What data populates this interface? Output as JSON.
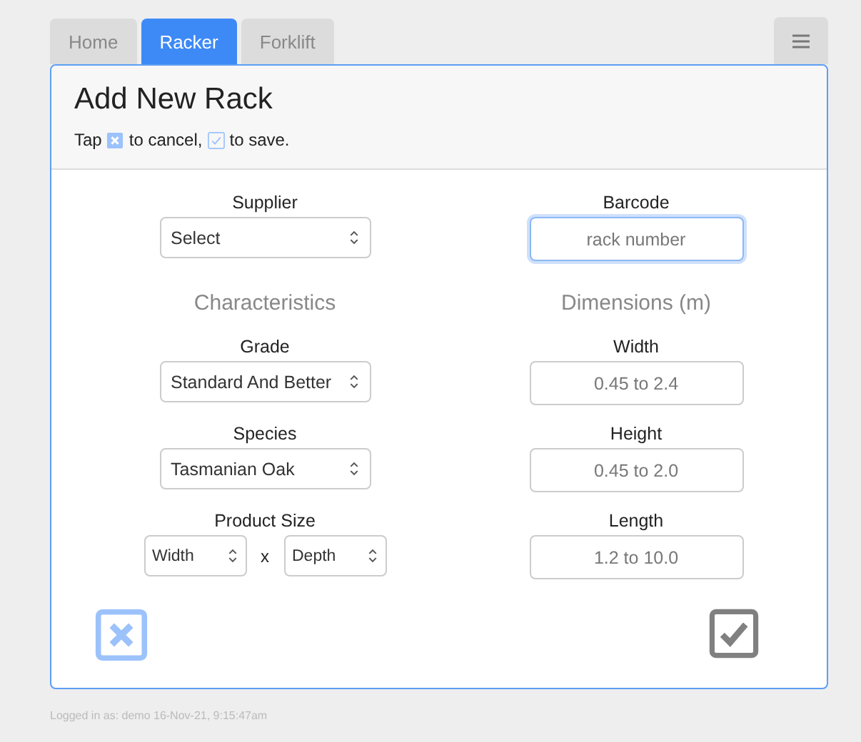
{
  "tabs": [
    {
      "label": "Home",
      "selected": false
    },
    {
      "label": "Racker",
      "selected": true
    },
    {
      "label": "Forklift",
      "selected": false
    }
  ],
  "title": "Add New Rack",
  "instructions": {
    "before": "Tap",
    "middle": "to cancel,",
    "after": "to save."
  },
  "rows": [
    {
      "left": {
        "kind": "select",
        "label": "Supplier",
        "value": "Select"
      },
      "right": {
        "kind": "input",
        "label": "Barcode",
        "placeholder": "rack number",
        "focused": true
      }
    },
    {
      "left": {
        "kind": "heading",
        "label": "Characteristics"
      },
      "right": {
        "kind": "heading",
        "label": "Dimensions (m)"
      }
    },
    {
      "left": {
        "kind": "select",
        "label": "Grade",
        "value": "Standard And Better"
      },
      "right": {
        "kind": "input",
        "label": "Width",
        "placeholder": "0.45 to 2.4",
        "focused": false
      }
    },
    {
      "left": {
        "kind": "select",
        "label": "Species",
        "value": "Tasmanian Oak"
      },
      "right": {
        "kind": "input",
        "label": "Height",
        "placeholder": "0.45 to 2.0",
        "focused": false
      }
    },
    {
      "left": {
        "kind": "pair",
        "label": "Product Size",
        "first": "Width",
        "separator": "x",
        "second": "Depth"
      },
      "right": {
        "kind": "input",
        "label": "Length",
        "placeholder": "1.2 to 10.0",
        "focused": false
      }
    }
  ],
  "actions": {
    "cancel_disabled": false,
    "save_disabled": true
  },
  "footer": "Logged in as: demo 16-Nov-21, 9:15:47am"
}
